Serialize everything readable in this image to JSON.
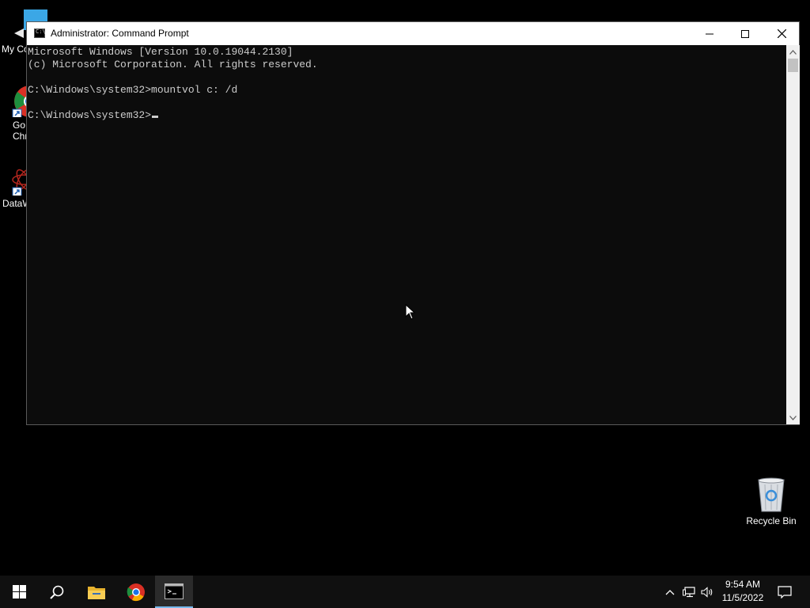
{
  "desktop": {
    "icons": [
      {
        "label": "My Co",
        "icon": "my-computer-icon"
      },
      {
        "label": "Go\nChr",
        "icon": "google-chrome-icon"
      },
      {
        "label": "DataW",
        "icon": "datawrapper-icon"
      },
      {
        "label": "Recycle Bin",
        "icon": "recycle-bin-icon"
      }
    ]
  },
  "window": {
    "title": "Administrator: Command Prompt",
    "controls": {
      "minimize": "minimize-icon",
      "maximize": "maximize-icon",
      "close": "close-icon"
    }
  },
  "console": {
    "lines": [
      "Microsoft Windows [Version 10.0.19044.2130]",
      "(c) Microsoft Corporation. All rights reserved.",
      "",
      "C:\\Windows\\system32>mountvol c: /d",
      "",
      "C:\\Windows\\system32>"
    ]
  },
  "taskbar": {
    "items": [
      "start-icon",
      "search-icon",
      "file-explorer-icon",
      "chrome-icon",
      "command-prompt-icon"
    ],
    "tray": [
      "chevron-up-icon",
      "network-icon",
      "volume-icon",
      "notifications-icon"
    ],
    "time": "9:54 AM",
    "date": "11/5/2022"
  }
}
